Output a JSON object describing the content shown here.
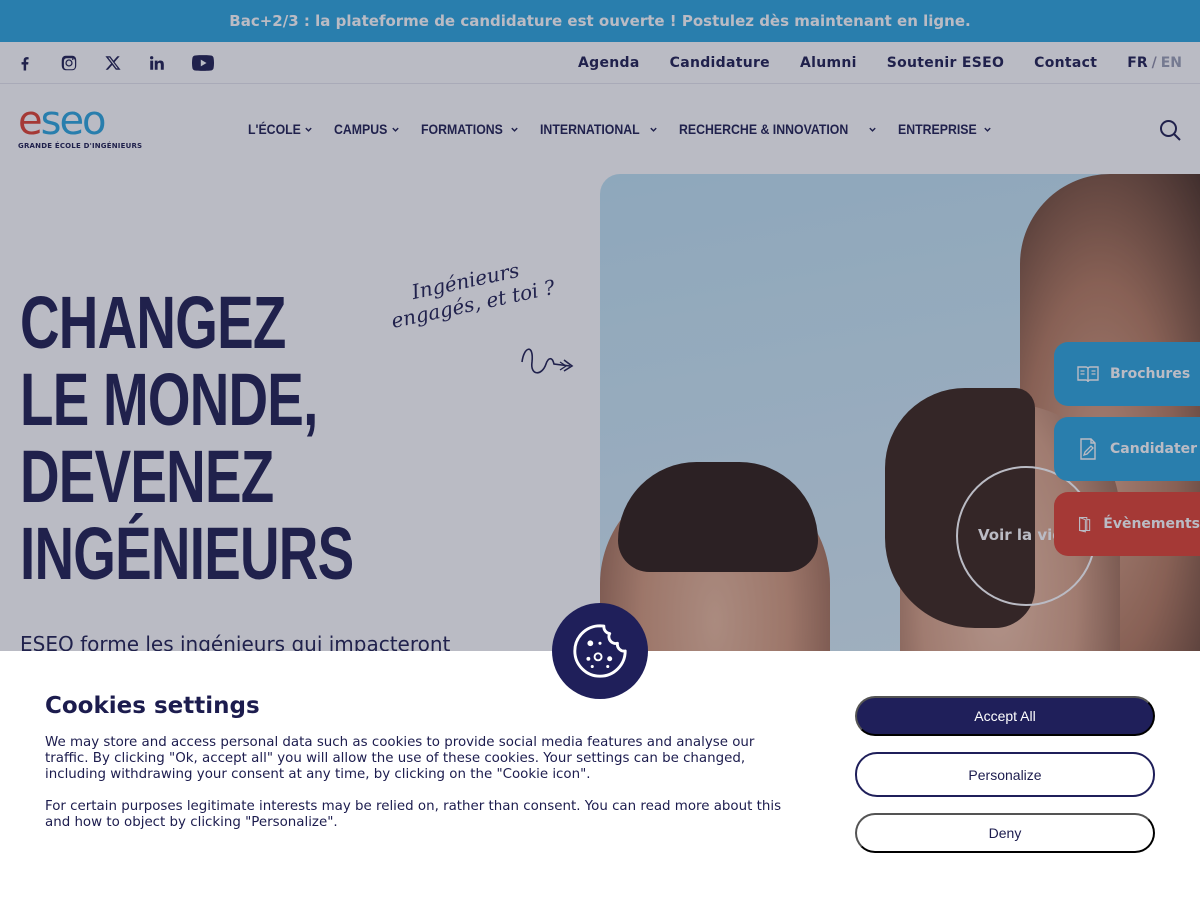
{
  "announcement": "Bac+2/3 : la plateforme de candidature est ouverte ! Postulez dès maintenant en ligne.",
  "social_icons": [
    "facebook-icon",
    "instagram-icon",
    "x-icon",
    "linkedin-icon",
    "youtube-icon"
  ],
  "utility_links": [
    "Agenda",
    "Candidature",
    "Alumni",
    "Soutenir ESEO",
    "Contact"
  ],
  "language": {
    "current": "FR",
    "separator": "/",
    "other": "EN"
  },
  "logo": {
    "mark_e": "e",
    "mark_rest": "seo",
    "subtitle": "GRANDE ÉCOLE D'INGÉNIEURS"
  },
  "nav": [
    "L'ÉCOLE",
    "CAMPUS",
    "FORMATIONS",
    "INTERNATIONAL",
    "RECHERCHE & INNOVATION",
    "ENTREPRISE"
  ],
  "hero": {
    "title_lines": [
      "CHANGEZ",
      "LE MONDE,",
      "DEVENEZ",
      "INGÉNIEURS"
    ],
    "script_lines": [
      "Ingénieurs",
      "engagés, et toi ?"
    ],
    "lead": "ESEO forme les ingénieurs qui impacteront",
    "video_label": "Voir la vidéo"
  },
  "side_tabs": [
    {
      "label": "Brochures",
      "icon": "book-icon",
      "color": "#2aa6dd"
    },
    {
      "label": "Candidater",
      "icon": "document-edit-icon",
      "color": "#2aa6dd"
    },
    {
      "label": "Évènements",
      "icon": "door-icon",
      "color": "#e0402e"
    }
  ],
  "cookie": {
    "title": "Cookies settings",
    "paragraph1": "We may store and access personal data such as cookies to provide social media features and analyse our traffic. By clicking \"Ok, accept all\" you will allow the use of these cookies. Your settings can be changed, including withdrawing your consent at any time, by clicking on the \"Cookie icon\".",
    "paragraph2": "For certain purposes legitimate interests may be relied on, rather than consent. You can read more about this and how to object by clicking \"Personalize\".",
    "accept": "Accept All",
    "personalize": "Personalize",
    "deny": "Deny"
  },
  "colors": {
    "navy": "#1c1c4e",
    "accent_blue": "#2aa6dd",
    "accent_red": "#e0402e",
    "button_navy": "#1f1f5a"
  }
}
